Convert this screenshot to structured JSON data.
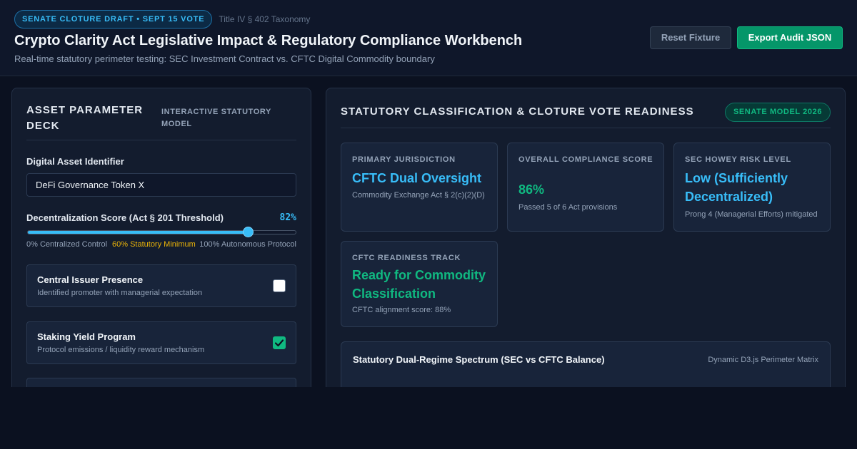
{
  "header": {
    "badge": "SENATE CLOTURE DRAFT • SEPT 15 VOTE",
    "taxonomy": "Title IV § 402 Taxonomy",
    "title": "Crypto Clarity Act Legislative Impact & Regulatory Compliance Workbench",
    "subtitle": "Real-time statutory perimeter testing: SEC Investment Contract vs. CFTC Digital Commodity boundary",
    "reset_label": "Reset Fixture",
    "export_label": "Export Audit JSON"
  },
  "asset_deck": {
    "title": "ASSET PARAMETER DECK",
    "subtitle": "INTERACTIVE STATUTORY MODEL",
    "identifier_label": "Digital Asset Identifier",
    "identifier_value": "DeFi Governance Token X",
    "decentralization": {
      "label": "Decentralization Score (Act § 201 Threshold)",
      "display": "82%",
      "value": 82,
      "scale_min": "0% Centralized Control",
      "scale_mid": "60% Statutory Minimum",
      "scale_max": "100% Autonomous Protocol"
    },
    "toggles": [
      {
        "title": "Central Issuer Presence",
        "desc": "Identified promoter with managerial expectation",
        "checked": false
      },
      {
        "title": "Staking Yield Program",
        "desc": "Protocol emissions / liquidity reward mechanism",
        "checked": true
      }
    ]
  },
  "classification": {
    "title": "STATUTORY CLASSIFICATION & CLOTURE VOTE READINESS",
    "model_badge": "SENATE MODEL 2026",
    "cards": [
      {
        "label": "PRIMARY JURISDICTION",
        "value": "CFTC Dual Oversight",
        "note": "Commodity Exchange Act § 2(c)(2)(D)",
        "color": "#38bdf8"
      },
      {
        "label": "OVERALL COMPLIANCE SCORE",
        "value": "86%",
        "note": "Passed 5 of 6 Act provisions",
        "color": "#10b981"
      },
      {
        "label": "SEC HOWEY RISK LEVEL",
        "value": "Low (Sufficiently Decentralized)",
        "note": "Prong 4 (Managerial Efforts) mitigated",
        "color": "#38bdf8"
      },
      {
        "label": "CFTC READINESS TRACK",
        "value": "Ready for Commodity Classification",
        "note": "CFTC alignment score: 88%",
        "color": "#10b981"
      }
    ],
    "spectrum": {
      "title": "Statutory Dual-Regime Spectrum (SEC vs CFTC Balance)",
      "tag": "Dynamic D3.js Perimeter Matrix"
    }
  }
}
